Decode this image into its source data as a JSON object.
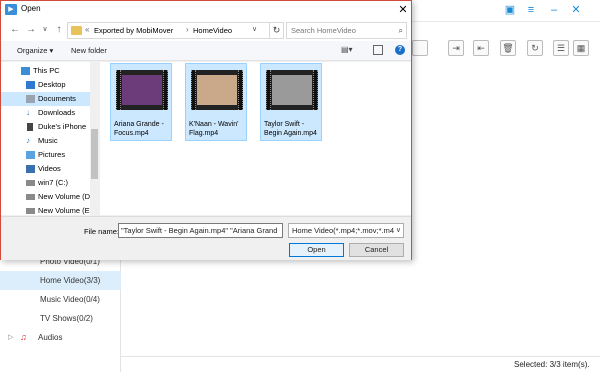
{
  "dialog": {
    "title": "Open",
    "address": {
      "crumbs": [
        "Exported by MobiMover",
        "HomeVideo"
      ]
    },
    "search_placeholder": "Search HomeVideo",
    "commands": {
      "organize": "Organize ▾",
      "new_folder": "New folder"
    },
    "nav_tree": [
      {
        "label": "This PC",
        "icon": "pc-icon",
        "selected": false
      },
      {
        "label": "Desktop",
        "icon": "folder-icon",
        "selected": false
      },
      {
        "label": "Documents",
        "icon": "folder-icon",
        "selected": true
      },
      {
        "label": "Downloads",
        "icon": "download-icon",
        "selected": false
      },
      {
        "label": "Duke's iPhone",
        "icon": "phone-icon",
        "selected": false
      },
      {
        "label": "Music",
        "icon": "music-icon",
        "selected": false
      },
      {
        "label": "Pictures",
        "icon": "pictures-icon",
        "selected": false
      },
      {
        "label": "Videos",
        "icon": "videos-icon",
        "selected": false
      },
      {
        "label": "win7 (C:)",
        "icon": "drive-icon",
        "selected": false
      },
      {
        "label": "New Volume (D:",
        "icon": "drive-icon",
        "selected": false
      },
      {
        "label": "New Volume (E:)",
        "icon": "drive-icon",
        "selected": false
      }
    ],
    "files": [
      {
        "name": "Ariana Grande - Focus.mp4",
        "thumb_color": "#6b3b7a"
      },
      {
        "name": "K'Naan - Wavin' Flag.mp4",
        "thumb_color": "#c9a98a"
      },
      {
        "name": "Taylor Swift - Begin Again.mp4",
        "thumb_color": "#9a9a9a"
      }
    ],
    "file_name_label": "File name:",
    "file_name_value": "\"Taylor Swift - Begin Again.mp4\" \"Ariana Grand",
    "file_type_value": "Home Video(*.mp4;*.mov;*.m4",
    "open_label": "Open",
    "cancel_label": "Cancel"
  },
  "app": {
    "sidebar": [
      {
        "label": "Photo Video(0/1)",
        "selected": false
      },
      {
        "label": "Home Video(3/3)",
        "selected": true
      },
      {
        "label": "Music Video(0/4)",
        "selected": false
      },
      {
        "label": "TV Shows(0/2)",
        "selected": false
      },
      {
        "label": "Audios",
        "selected": false
      }
    ],
    "status": "Selected: 3/3 item(s).",
    "accent_color": "#1a8ad4"
  }
}
